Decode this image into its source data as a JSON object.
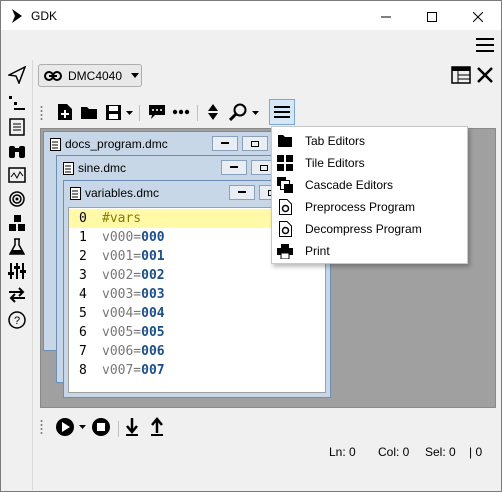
{
  "window": {
    "title": "GDK",
    "minimize_label": "Minimize",
    "maximize_label": "Maximize",
    "close_label": "Close"
  },
  "controller": {
    "name": "DMC4040"
  },
  "documents": [
    {
      "title": "docs_program.dmc"
    },
    {
      "title": "sine.dmc"
    },
    {
      "title": "variables.dmc"
    }
  ],
  "editor": {
    "lines": [
      {
        "num": "0",
        "name": "#vars",
        "value": ""
      },
      {
        "num": "1",
        "name": "v000=",
        "value": "000"
      },
      {
        "num": "2",
        "name": "v001=",
        "value": "001"
      },
      {
        "num": "3",
        "name": "v002=",
        "value": "002"
      },
      {
        "num": "4",
        "name": "v003=",
        "value": "003"
      },
      {
        "num": "5",
        "name": "v004=",
        "value": "004"
      },
      {
        "num": "6",
        "name": "v005=",
        "value": "005"
      },
      {
        "num": "7",
        "name": "v006=",
        "value": "006"
      },
      {
        "num": "8",
        "name": "v007=",
        "value": "007"
      }
    ]
  },
  "menu": {
    "items": [
      {
        "label": "Tab Editors",
        "icon": "folder-icon"
      },
      {
        "label": "Tile Editors",
        "icon": "tile-icon"
      },
      {
        "label": "Cascade Editors",
        "icon": "cascade-icon"
      },
      {
        "label": "Preprocess Program",
        "icon": "gear-document-icon"
      },
      {
        "label": "Decompress Program",
        "icon": "gear-document-icon"
      },
      {
        "label": "Print",
        "icon": "printer-icon"
      }
    ]
  },
  "status": {
    "line": "Ln: 0",
    "col": "Col: 0",
    "sel": "Sel: 0",
    "extra": "| 0"
  },
  "colors": {
    "accent": "#1b4f8a",
    "current_line": "#fff9a8",
    "menu_toggle_active": "#d6e7f7"
  }
}
